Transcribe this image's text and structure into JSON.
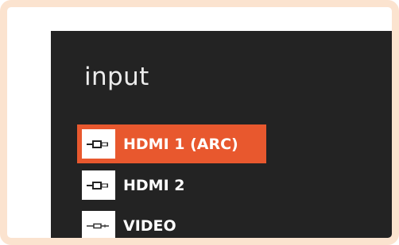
{
  "menu": {
    "title": "input",
    "items": [
      {
        "label": "HDMI 1 (ARC)",
        "icon": "hdmi-cable-icon",
        "selected": true
      },
      {
        "label": "HDMI 2",
        "icon": "hdmi-cable-icon",
        "selected": false
      },
      {
        "label": "VIDEO",
        "icon": "composite-cable-icon",
        "selected": false
      }
    ]
  },
  "colors": {
    "frame_border": "#fbe3cf",
    "screen_background": "#232323",
    "selected_highlight": "#e8582e",
    "text": "#ffffff"
  }
}
